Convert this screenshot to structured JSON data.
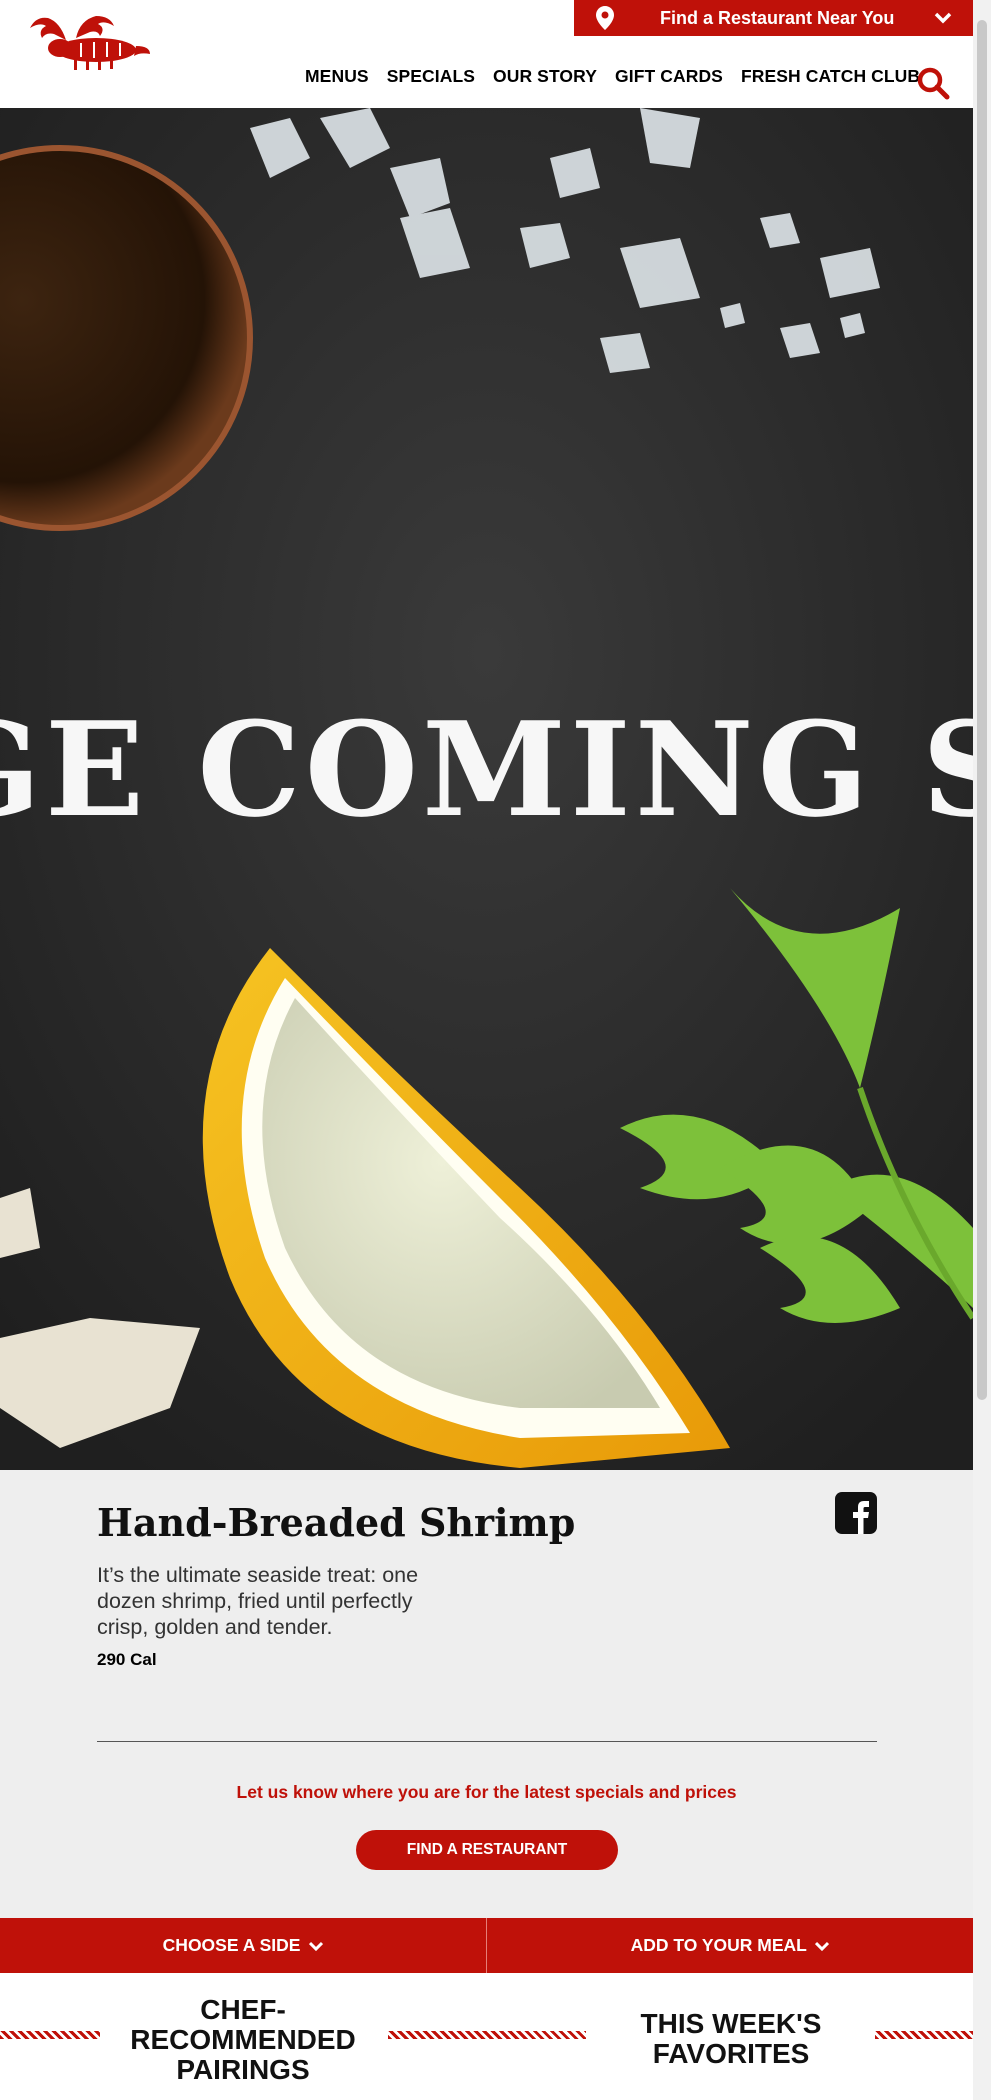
{
  "header": {
    "locator_text": "Find a Restaurant Near You",
    "nav": [
      "MENUS",
      "SPECIALS",
      "OUR STORY",
      "GIFT CARDS",
      "FRESH CATCH CLUB"
    ]
  },
  "hero": {
    "text": "GE COMING SO"
  },
  "product": {
    "title": "Hand-Breaded Shrimp",
    "description": "It’s the ultimate seaside treat: one dozen shrimp, fried until perfectly crisp, golden and tender.",
    "calories": "290 Cal"
  },
  "cta": {
    "notice": "Let us know where you are for the latest specials and prices",
    "button": "FIND A RESTAURANT"
  },
  "tabs": [
    "CHOOSE A SIDE",
    "ADD TO YOUR MEAL"
  ],
  "sections": [
    "CHEF-RECOMMENDED PAIRINGS",
    "THIS WEEK'S FAVORITES"
  ],
  "colors": {
    "brand_red": "#bf1109"
  }
}
